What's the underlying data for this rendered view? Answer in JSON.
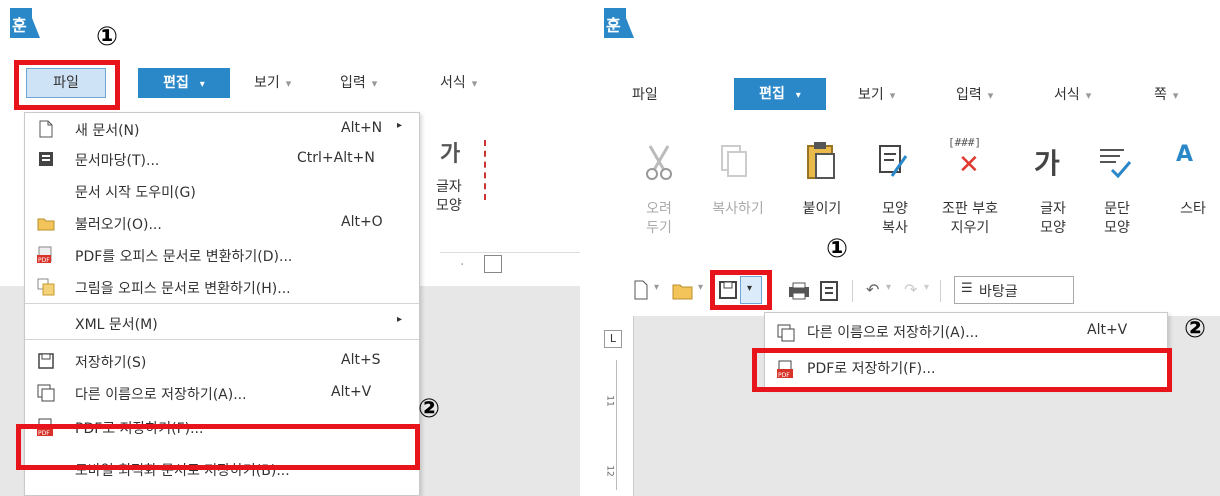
{
  "colors": {
    "accent": "#2a87c8",
    "highlight": "#e8141b",
    "file_tab": "#cfe3f6"
  },
  "left": {
    "logo_char": "훈",
    "menu": {
      "file": "파일",
      "edit": "편집",
      "view": "보기",
      "input": "입력",
      "format": "서식"
    },
    "markers": {
      "one": "①",
      "two": "②"
    },
    "dropdown": [
      {
        "label": "새 문서(N)",
        "shortcut": "Alt+N",
        "icon": "new-doc-icon",
        "has_submenu": true
      },
      {
        "label": "문서마당(T)...",
        "shortcut": "Ctrl+Alt+N",
        "icon": "doc-template-icon"
      },
      {
        "label": "문서 시작 도우미(G)",
        "shortcut": ""
      },
      {
        "label": "불러오기(O)...",
        "shortcut": "Alt+O",
        "icon": "open-folder-icon"
      },
      {
        "label": "PDF를 오피스 문서로 변환하기(D)...",
        "shortcut": "",
        "icon": "pdf-convert-icon"
      },
      {
        "label": "그림을 오피스 문서로 변환하기(H)...",
        "shortcut": "",
        "icon": "image-convert-icon"
      },
      {
        "label": "XML 문서(M)",
        "shortcut": "",
        "has_submenu": true
      },
      {
        "label": "저장하기(S)",
        "shortcut": "Alt+S",
        "icon": "save-icon"
      },
      {
        "label": "다른 이름으로 저장하기(A)...",
        "shortcut": "Alt+V",
        "icon": "save-as-icon"
      },
      {
        "label": "PDF로 저장하기(F)...",
        "shortcut": "",
        "icon": "pdf-save-icon"
      },
      {
        "label": "모바일 최적화 문서로 저장하기(B)...",
        "shortcut": ""
      }
    ],
    "ribbon_partial": {
      "char_style": "글자\n모양",
      "glyph": "가"
    }
  },
  "right": {
    "logo_char": "훈",
    "menu": {
      "file": "파일",
      "edit": "편집",
      "view": "보기",
      "input": "입력",
      "format": "서식",
      "page": "쪽"
    },
    "markers": {
      "one": "①",
      "two": "②"
    },
    "ribbon": [
      {
        "label": "오려\n두기",
        "icon": "cut-icon",
        "disabled": true
      },
      {
        "label": "복사하기",
        "icon": "copy-icon",
        "disabled": true
      },
      {
        "label": "붙이기",
        "icon": "paste-icon",
        "disabled": false
      },
      {
        "label": "모양\n복사",
        "icon": "format-painter-icon",
        "disabled": false
      },
      {
        "label": "조판 부호\n지우기",
        "icon": "clear-markup-icon",
        "disabled": false
      },
      {
        "label": "글자\n모양",
        "icon": "char-shape-icon",
        "disabled": false
      },
      {
        "label": "문단\n모양",
        "icon": "paragraph-shape-icon",
        "disabled": false
      },
      {
        "label": "스타",
        "icon": "style-icon",
        "disabled": false
      }
    ],
    "clear_markup_glyph": "[###]",
    "style_box": "바탕글",
    "dropdown": [
      {
        "label": "다른 이름으로 저장하기(A)...",
        "shortcut": "Alt+V",
        "icon": "save-as-icon"
      },
      {
        "label": "PDF로 저장하기(F)...",
        "shortcut": "",
        "icon": "pdf-save-icon"
      }
    ],
    "ruler": {
      "corner": "L",
      "ticks": [
        "11",
        "12"
      ]
    }
  }
}
